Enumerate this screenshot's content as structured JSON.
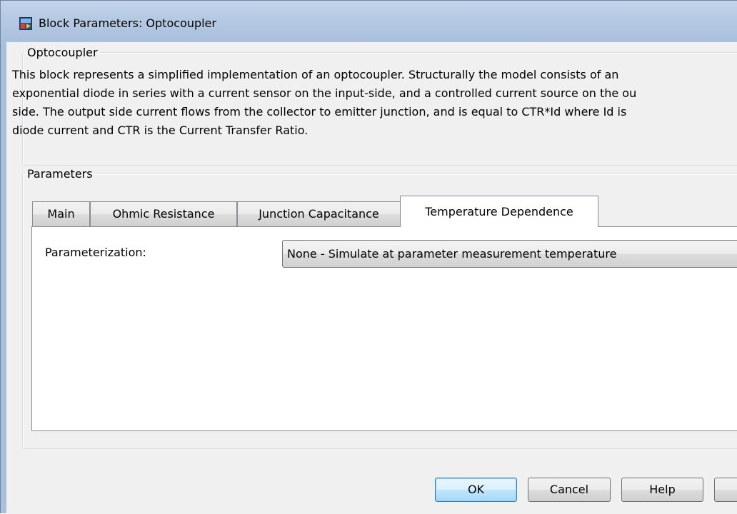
{
  "window": {
    "title": "Block Parameters: Optocoupler"
  },
  "description_group": {
    "legend": "Optocoupler",
    "lines": [
      "This block represents a simplified implementation of an optocoupler. Structurally the model consists of an",
      "exponential diode in series with a current sensor on the input-side, and a controlled current source on the ou",
      "side. The output side current flows from the collector to emitter junction, and is equal to CTR*Id where Id is",
      "diode current and CTR is the Current Transfer Ratio."
    ]
  },
  "parameters_group": {
    "legend": "Parameters",
    "tabs": [
      {
        "label": "Main",
        "active": false
      },
      {
        "label": "Ohmic Resistance",
        "active": false
      },
      {
        "label": "Junction Capacitance",
        "active": false
      },
      {
        "label": "Temperature Dependence",
        "active": true
      }
    ],
    "fields": {
      "parameterization_label": "Parameterization:",
      "parameterization_value": "None - Simulate at parameter measurement temperature"
    }
  },
  "buttons": {
    "ok": "OK",
    "cancel": "Cancel",
    "help": "Help",
    "apply": ""
  },
  "colors": {
    "title_bar": "#a9c0db",
    "dialog_bg": "#f0f0f0",
    "default_button": "#bee6fd"
  },
  "icons": {
    "app": "simulink-block-icon"
  }
}
